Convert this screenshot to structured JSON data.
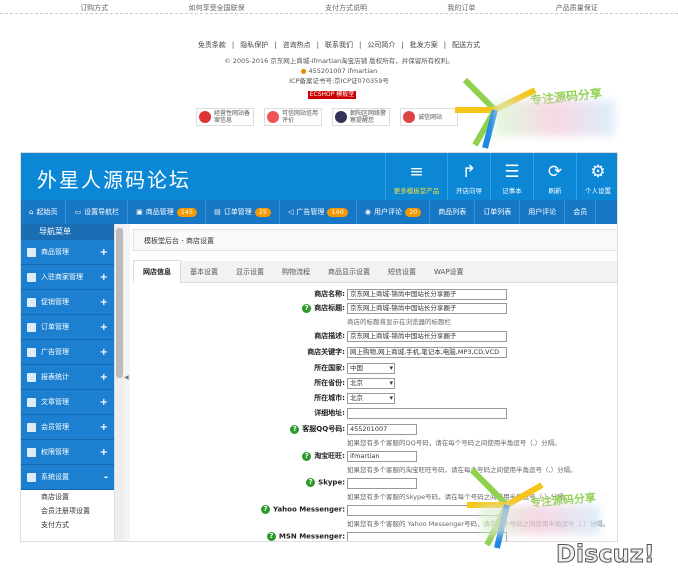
{
  "topnav": [
    "订购方式",
    "如何享受全国联保",
    "支付方式说明",
    "我的订单",
    "产品质量保证"
  ],
  "footer": {
    "links": [
      "免责条款",
      "|",
      "隐私保护",
      "|",
      "咨询热点",
      "|",
      "联系我们",
      "|",
      "公司简介",
      "|",
      "批发方案",
      "|",
      "配送方式"
    ],
    "copyright": "© 2005-2016 京东网上商城-ifmartian淘宝店铺 版权所有，并保留所有权利。",
    "contact": "455201007  ifmartian",
    "icp": "ICP备案证书号:京ICP证070359号",
    "ecshop": "ECSHOP 模板堂",
    "badges": [
      {
        "label": "经营性网站备案信息",
        "color": "#d33"
      },
      {
        "label": "可信网站信用评价",
        "color": "#e55"
      },
      {
        "label": "朝阳区网络警察提醒您",
        "color": "#335"
      },
      {
        "label": "诚信网站",
        "color": "#d44"
      }
    ]
  },
  "watermark": {
    "text": "专注源码分享"
  },
  "admin": {
    "brand": "外星人源码论坛",
    "tools": [
      {
        "icon": "≡",
        "label": "更多模板堂产品",
        "name": "menu-icon",
        "wide": true
      },
      {
        "icon": "↱",
        "label": "开店向导",
        "name": "share-arrow-icon"
      },
      {
        "icon": "☰",
        "label": "记事本",
        "name": "notepad-icon"
      },
      {
        "icon": "⟳",
        "label": "刷新",
        "name": "refresh-icon"
      },
      {
        "icon": "⚙",
        "label": "个人设置",
        "name": "gear-icon"
      }
    ],
    "nav": [
      {
        "icon": "⌂",
        "label": "起始页",
        "count": ""
      },
      {
        "icon": "▭",
        "label": "设置导航栏",
        "count": ""
      },
      {
        "icon": "▣",
        "label": "商品管理",
        "count": "145"
      },
      {
        "icon": "▤",
        "label": "订单管理",
        "count": "25"
      },
      {
        "icon": "◁",
        "label": "广告管理",
        "count": "140"
      },
      {
        "icon": "◉",
        "label": "用户评论",
        "count": "20"
      },
      {
        "icon": "",
        "label": "商品列表",
        "count": ""
      },
      {
        "icon": "",
        "label": "订单列表",
        "count": ""
      },
      {
        "icon": "",
        "label": "用户评论",
        "count": ""
      },
      {
        "icon": "",
        "label": "会员",
        "count": ""
      }
    ],
    "side": {
      "head": "导航菜单",
      "items": [
        "商品管理",
        "入驻商家管理",
        "促销管理",
        "订单管理",
        "广告管理",
        "报表统计",
        "文章管理",
        "会员管理",
        "权限管理",
        "系统设置"
      ],
      "collapse_symbol": "-",
      "expand_symbol": "+",
      "subs": [
        "商店设置",
        "会员注册项设置",
        "支付方式"
      ]
    },
    "collapse_arrow": "◀",
    "breadcrumb": "模板堂后台  - 商店设置",
    "tabs": [
      "网店信息",
      "基本设置",
      "显示设置",
      "购物流程",
      "商品显示设置",
      "短信设置",
      "WAP设置"
    ],
    "form": {
      "shop_name": {
        "label": "商店名称:",
        "value": "京东网上商城-锦尚中国站长分享圈子"
      },
      "shop_title": {
        "label": "商店标题:",
        "value": "京东网上商城-锦尚中国站长分享圈子",
        "hint": "商店的标题将显示在浏览器的标题栏"
      },
      "shop_desc": {
        "label": "商店描述:",
        "value": "京东网上商城-锦尚中国站长分享圈子"
      },
      "shop_keywords": {
        "label": "商店关键字:",
        "value": "网上购物,网上商城,手机,笔记本,电脑,MP3,CD,VCD"
      },
      "country": {
        "label": "所在国家:",
        "value": "中国"
      },
      "province": {
        "label": "所在省份:",
        "value": "北京"
      },
      "city": {
        "label": "所在城市:",
        "value": "北京"
      },
      "address": {
        "label": "详细地址:",
        "value": ""
      },
      "qq": {
        "label": "客服QQ号码:",
        "value": "455201007",
        "hint": "如果您有多个客服的QQ号码，请在每个号码之间使用半角逗号（,）分隔。"
      },
      "wangwang": {
        "label": "淘宝旺旺:",
        "value": "ifmartian",
        "hint": "如果您有多个客服的淘宝旺旺号码，请在每个号码之间使用半角逗号（,）分隔。"
      },
      "skype": {
        "label": "Skype:",
        "value": "",
        "hint": "如果您有多个客服的Skype号码，请在每个号码之间使用半角逗号（,）分隔。"
      },
      "yahoo": {
        "label": "Yahoo Messenger:",
        "value": "",
        "hint": "如果您有多个客服的 Yahoo Messenger号码，请在每个号码之间使用半角逗号（,）分隔。"
      },
      "msn": {
        "label": "MSN Messenger:",
        "value": ""
      }
    }
  },
  "discuz": "Discuz!"
}
